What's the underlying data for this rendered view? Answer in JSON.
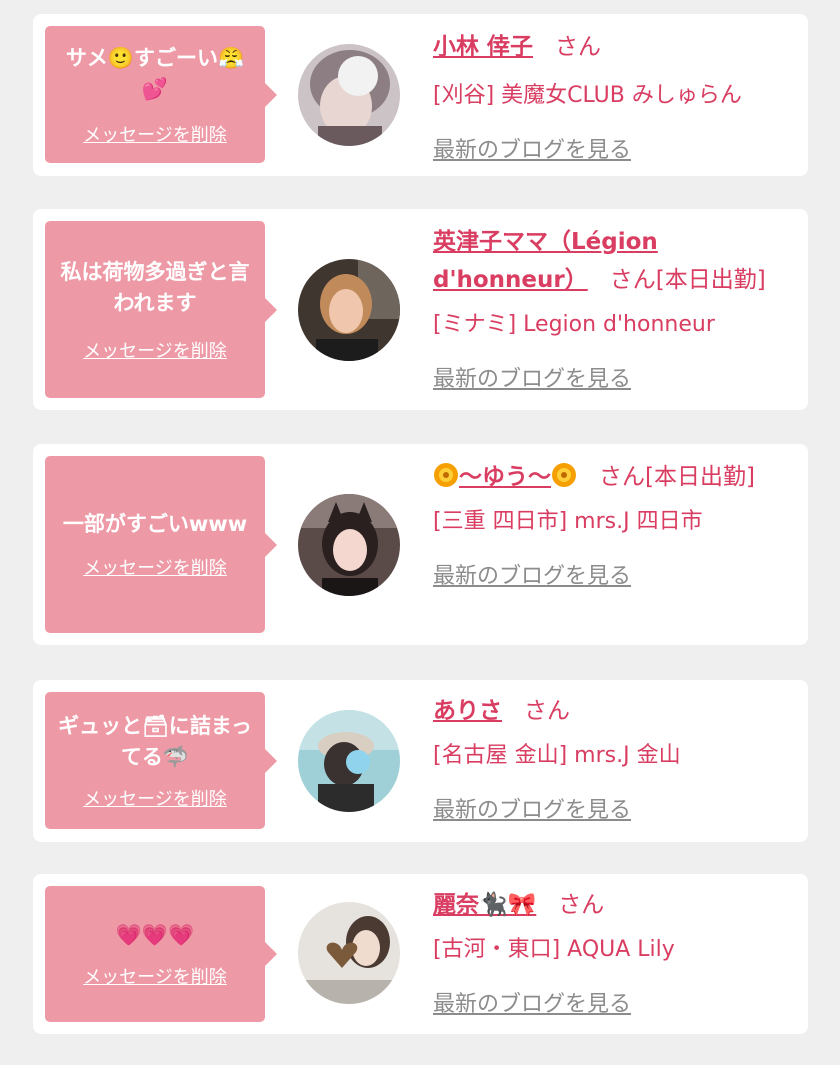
{
  "favorites": [
    {
      "message": "サメ🙂すごーい😤💕",
      "delete_label": "メッセージを削除",
      "name": "小林 倖子",
      "honorific": "さん",
      "status": "",
      "shop": "[刈谷] 美魔女CLUB みしゅらん",
      "blog_label": "最新のブログを見る"
    },
    {
      "message": "私は荷物多過ぎと言われます",
      "delete_label": "メッセージを削除",
      "name": "英津子ママ（Légion d'honneur）",
      "honorific": "さん",
      "status": "[本日出勤]",
      "shop": "[ミナミ] Legion d'honneur",
      "blog_label": "最新のブログを見る"
    },
    {
      "message": "一部がすごいwww",
      "delete_label": "メッセージを削除",
      "name": "〜ゆう〜",
      "honorific": "さん",
      "status": "[本日出勤]",
      "shop": "[三重 四日市] mrs.J 四日市",
      "blog_label": "最新のブログを見る"
    },
    {
      "message": "ギュッと🗃に詰まってる🦈",
      "delete_label": "メッセージを削除",
      "name": "ありさ",
      "honorific": "さん",
      "status": "",
      "shop": "[名古屋 金山] mrs.J 金山",
      "blog_label": "最新のブログを見る"
    },
    {
      "message": "💗💗💗",
      "delete_label": "メッセージを削除",
      "name": "麗奈🐈‍⬛🎀",
      "honorific": "さん",
      "status": "",
      "shop": "[古河・東口] AQUA Lily",
      "blog_label": "最新のブログを見る"
    }
  ],
  "colors": {
    "background": "#efefef",
    "card": "#ffffff",
    "bubble": "#ee9aa6",
    "accent": "#d93d61",
    "link_gray": "#8c8c8c"
  }
}
